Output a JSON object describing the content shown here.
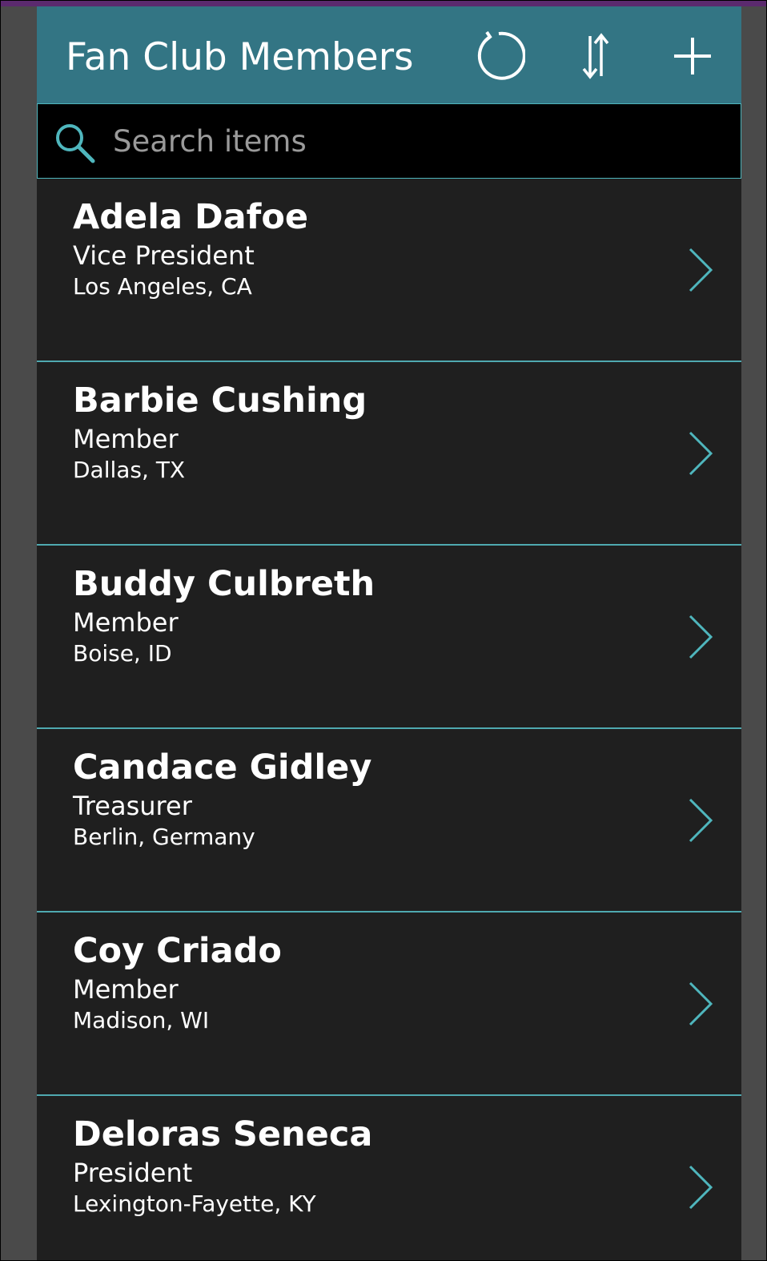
{
  "header": {
    "title": "Fan Club Members",
    "refresh_icon": "refresh-icon",
    "sort_icon": "sort-icon",
    "add_icon": "plus-icon"
  },
  "search": {
    "placeholder": "Search items",
    "value": "",
    "icon": "search-icon"
  },
  "members": [
    {
      "name": "Adela Dafoe",
      "role": "Vice President",
      "location": "Los Angeles, CA"
    },
    {
      "name": "Barbie Cushing",
      "role": "Member",
      "location": "Dallas, TX"
    },
    {
      "name": "Buddy Culbreth",
      "role": "Member",
      "location": "Boise, ID"
    },
    {
      "name": "Candace Gidley",
      "role": "Treasurer",
      "location": "Berlin, Germany"
    },
    {
      "name": "Coy Criado",
      "role": "Member",
      "location": "Madison, WI"
    },
    {
      "name": "Deloras Seneca",
      "role": "President",
      "location": "Lexington-Fayette, KY"
    }
  ],
  "colors": {
    "header_bg": "#337584",
    "accent": "#4fb6bd",
    "list_bg": "#1f1f1f",
    "search_bg": "#000000",
    "top_strip": "#5b2a6e"
  }
}
